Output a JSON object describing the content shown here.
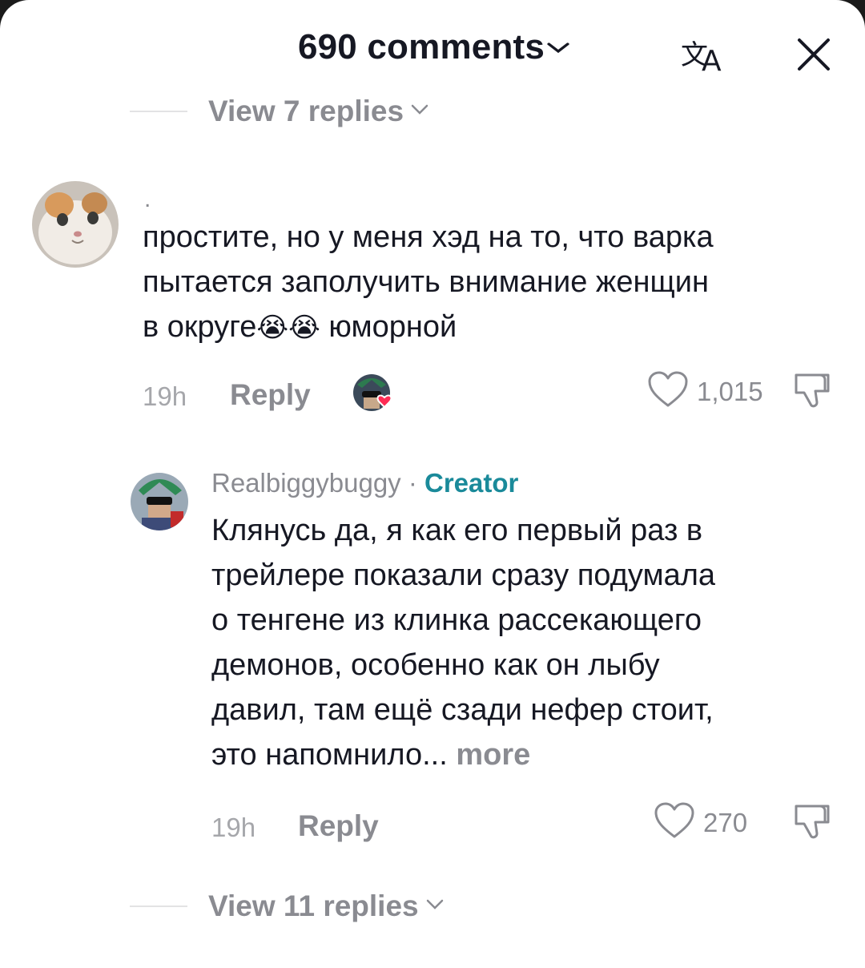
{
  "header": {
    "title": "690 comments",
    "chevron": "⌄",
    "translate_icon": "translate-icon",
    "close_icon": "close-icon"
  },
  "top_replies": {
    "label": "View 7 replies"
  },
  "comment1": {
    "username": ".",
    "text": "простите, но у меня хэд на то, что варка\nпытается заполучить внимание женщин\nв округе",
    "emoji": "😭😭",
    "text_tail": " юморной",
    "time": "19h",
    "reply_label": "Reply",
    "likes": "1,015"
  },
  "comment2": {
    "username": "Realbiggybuggy",
    "separator": " · ",
    "badge": "Creator",
    "text": "Клянусь да, я как его первый раз в\nтрейлере показали сразу подумала\nо тенгене из клинка рассекающего\nдемонов, особенно как он лыбу\nдавил, там ещё сзади нефер стоит,\nэто напомнило...",
    "more_label": " more",
    "time": "19h",
    "reply_label": "Reply",
    "likes": "270"
  },
  "bottom_replies": {
    "label": "View 11 replies"
  }
}
